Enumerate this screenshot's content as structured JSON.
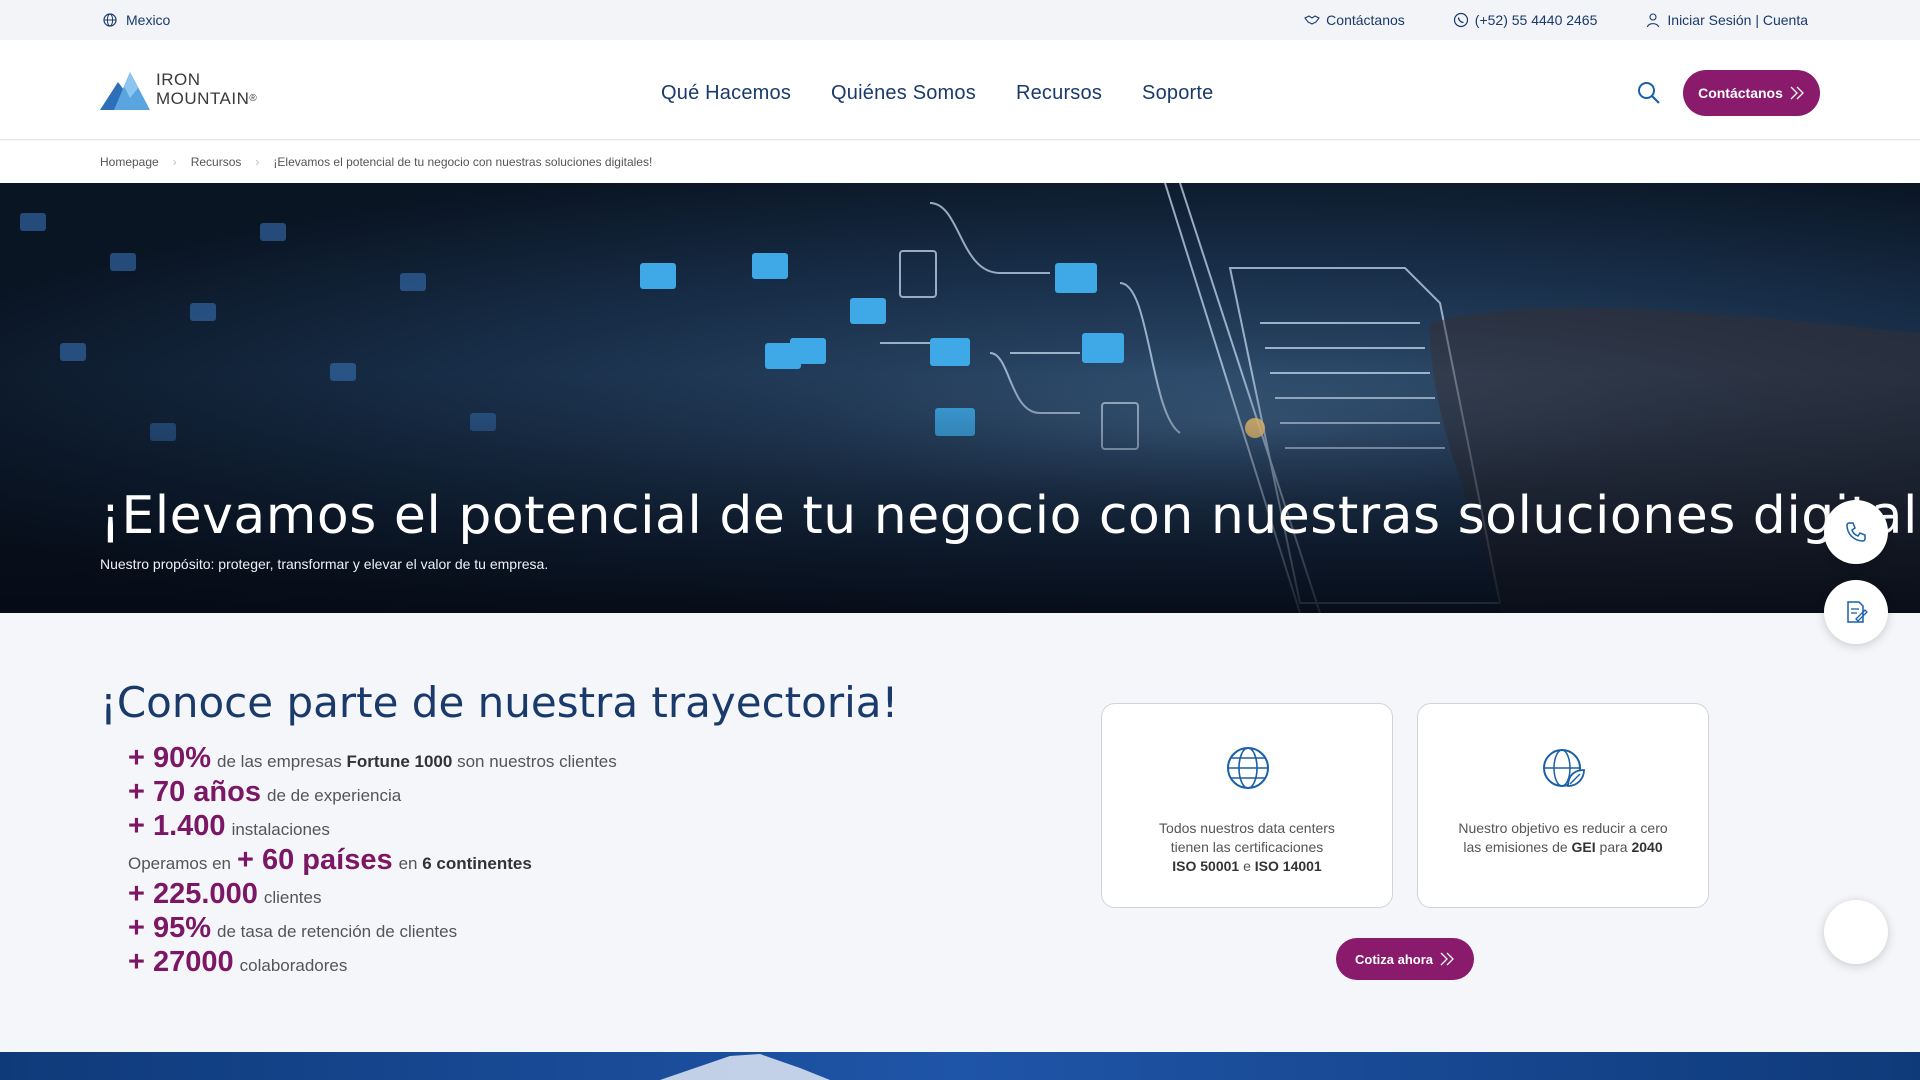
{
  "utility": {
    "region": "Mexico",
    "contact": "Contáctanos",
    "phone": "(+52) 55 4440 2465",
    "account": "Iniciar Sesión | Cuenta"
  },
  "header": {
    "logo_line1": "IRON",
    "logo_line2": "MOUNTAIN",
    "logo_mark": "®",
    "nav": [
      "Qué Hacemos",
      "Quiénes Somos",
      "Recursos",
      "Soporte"
    ],
    "cta": "Contáctanos"
  },
  "breadcrumb": [
    "Homepage",
    "Recursos",
    "¡Elevamos el potencial de tu negocio con nuestras soluciones digitales!"
  ],
  "hero": {
    "title": "¡Elevamos el potencial de tu negocio con nuestras soluciones digitales!",
    "subtitle": "Nuestro propósito: proteger, transformar y elevar el valor de tu empresa."
  },
  "section": {
    "title": "¡Conoce parte de nuestra trayectoria!",
    "stats": [
      {
        "pre": "",
        "big": "+ 90%",
        "text1": "de las empresas",
        "bold": "Fortune 1000",
        "text2": "son nuestros clientes"
      },
      {
        "pre": "",
        "big": "+ 70 años",
        "text1": "de de experiencia",
        "bold": "",
        "text2": ""
      },
      {
        "pre": "",
        "big": "+ 1.400",
        "text1": "instalaciones",
        "bold": "",
        "text2": ""
      },
      {
        "pre": "Operamos en",
        "big": "+ 60 países",
        "text1": "en",
        "bold": "6 continentes",
        "text2": ""
      },
      {
        "pre": "",
        "big": "+ 225.000",
        "text1": "clientes",
        "bold": "",
        "text2": ""
      },
      {
        "pre": "",
        "big": "+ 95%",
        "text1": "de tasa de retención de clientes",
        "bold": "",
        "text2": ""
      },
      {
        "pre": "",
        "big": "+ 27000",
        "text1": "colaboradores",
        "bold": "",
        "text2": ""
      }
    ],
    "card1": {
      "line1": "Todos nuestros data centers",
      "line2": "tienen las certificaciones",
      "b1": "ISO 50001",
      "mid": "e",
      "b2": "ISO 14001",
      "icon": "globe-icon"
    },
    "card2": {
      "line1": "Nuestro objetivo es reducir a cero",
      "line2a": "las emisiones de",
      "b1": "GEI",
      "line2b": "para",
      "b2": "2040",
      "icon": "eco-globe-icon"
    },
    "quote": "Cotiza ahora"
  },
  "colors": {
    "brand_purple": "#8a1a6b",
    "navy": "#1a3a6b",
    "stat_purple": "#7c1766"
  }
}
